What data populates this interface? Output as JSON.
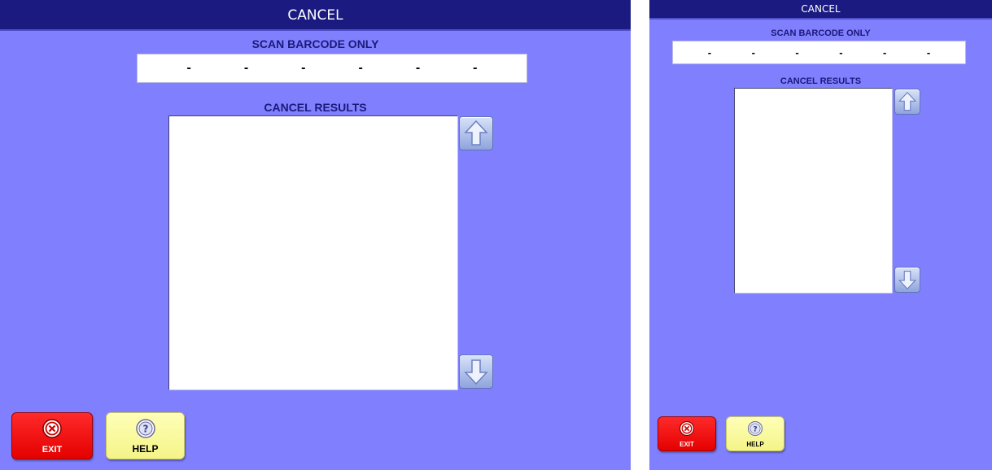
{
  "screens": [
    {
      "title": "CANCEL",
      "scan_label": "SCAN BARCODE ONLY",
      "barcode_segments": [
        "-",
        "-",
        "-",
        "-",
        "-",
        "-"
      ],
      "results_label": "CANCEL RESULTS",
      "exit_label": "EXIT",
      "help_label": "HELP"
    },
    {
      "title": "CANCEL",
      "scan_label": "SCAN BARCODE ONLY",
      "barcode_segments": [
        "-",
        "-",
        "-",
        "-",
        "-",
        "-"
      ],
      "results_label": "CANCEL RESULTS",
      "exit_label": "EXIT",
      "help_label": "HELP"
    }
  ],
  "icons": {
    "scroll_up": "up-arrow-icon",
    "scroll_down": "down-arrow-icon",
    "exit": "close-circle-icon",
    "help": "question-circle-icon"
  },
  "colors": {
    "panel_background": "#8080ff",
    "title_bar": "#1a1a80",
    "exit_button": "#ff1a1a",
    "help_button": "#ffff99"
  }
}
